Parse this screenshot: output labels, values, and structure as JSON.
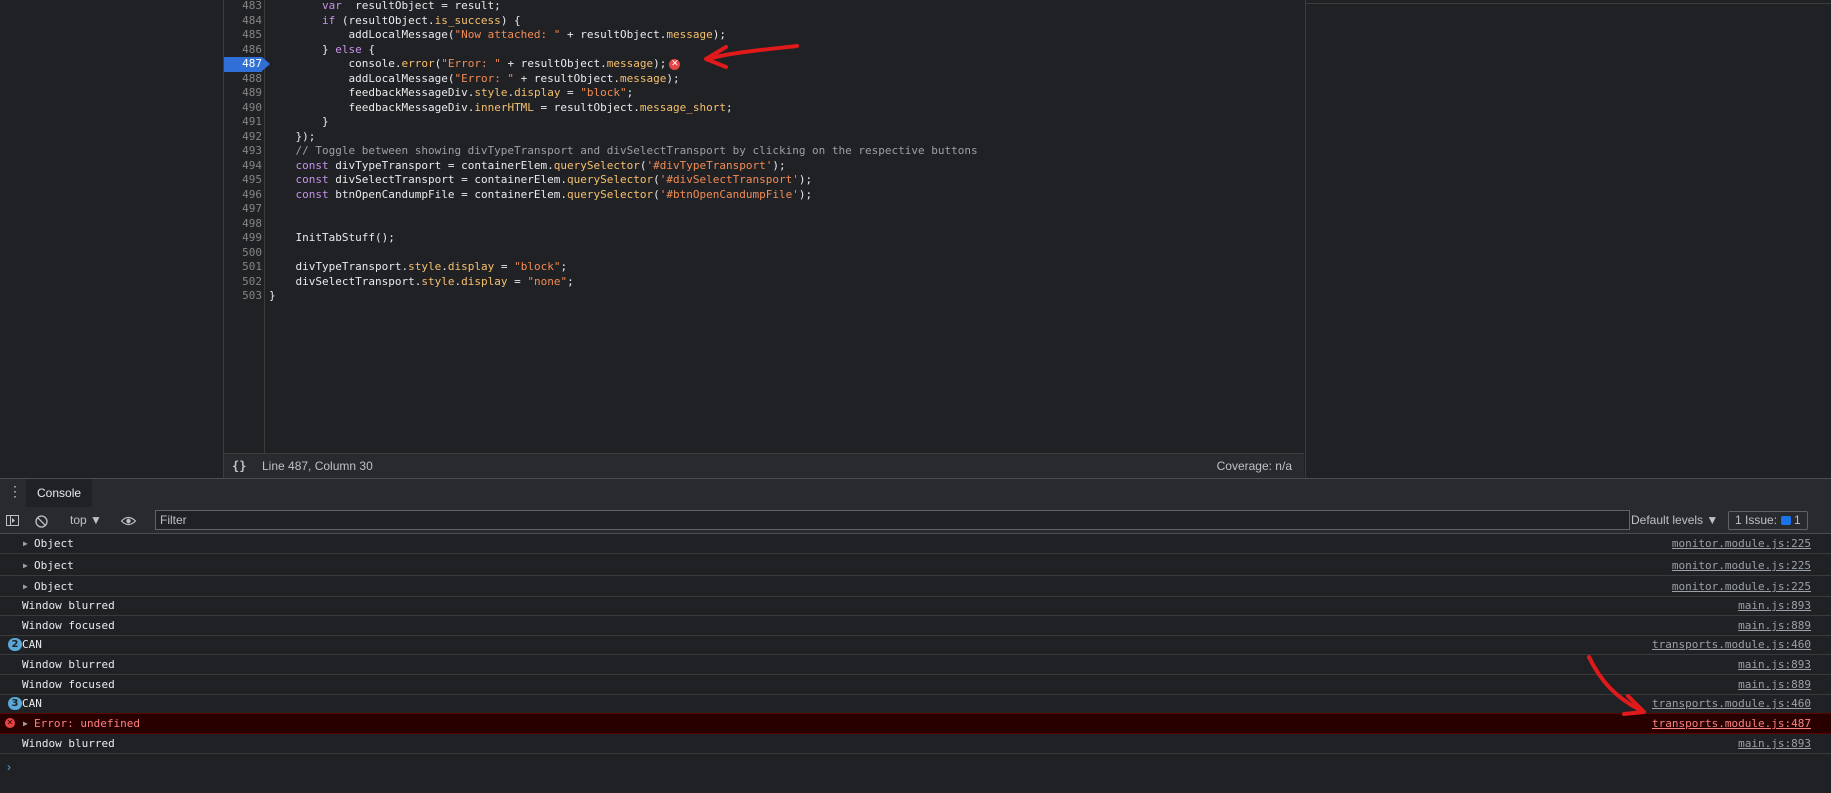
{
  "editor": {
    "lines": [
      {
        "num": "483",
        "indent": "        ",
        "segments": [
          [
            "kw",
            "var"
          ],
          [
            "",
            "  resultObject = result;"
          ]
        ]
      },
      {
        "num": "484",
        "indent": "        ",
        "segments": [
          [
            "kw",
            "if"
          ],
          [
            "",
            " (resultObject."
          ],
          [
            "prop",
            "is_success"
          ],
          [
            "",
            ") {"
          ]
        ]
      },
      {
        "num": "485",
        "indent": "            ",
        "segments": [
          [
            "",
            "addLocalMessage("
          ],
          [
            "str",
            "\"Now attached: \""
          ],
          [
            "",
            ""
          ],
          [
            "",
            " + resultObject."
          ],
          [
            "prop",
            "message"
          ],
          [
            "",
            ");"
          ]
        ]
      },
      {
        "num": "486",
        "indent": "        ",
        "segments": [
          [
            "",
            "} "
          ],
          [
            "kw",
            "else"
          ],
          [
            "",
            " {"
          ]
        ]
      },
      {
        "num": "487",
        "indent": "            ",
        "segments": [
          [
            "",
            "console."
          ],
          [
            "prop",
            "error"
          ],
          [
            "",
            "("
          ],
          [
            "str",
            "\"Error: \""
          ],
          [
            "",
            " + resultObject."
          ],
          [
            "prop",
            "message"
          ],
          [
            "",
            ");"
          ]
        ],
        "active": true,
        "error": true
      },
      {
        "num": "488",
        "indent": "            ",
        "segments": [
          [
            "",
            "addLocalMessage("
          ],
          [
            "str",
            "\"Error: \""
          ],
          [
            "",
            " + resultObject."
          ],
          [
            "prop",
            "message"
          ],
          [
            "",
            ");"
          ]
        ]
      },
      {
        "num": "489",
        "indent": "            ",
        "segments": [
          [
            "",
            "feedbackMessageDiv."
          ],
          [
            "prop",
            "style"
          ],
          [
            "",
            "."
          ],
          [
            "prop",
            "display"
          ],
          [
            "",
            " = "
          ],
          [
            "str",
            "\"block\""
          ],
          [
            "",
            ";"
          ]
        ]
      },
      {
        "num": "490",
        "indent": "            ",
        "segments": [
          [
            "",
            "feedbackMessageDiv."
          ],
          [
            "prop",
            "innerHTML"
          ],
          [
            "",
            " = resultObject."
          ],
          [
            "prop",
            "message_short"
          ],
          [
            "",
            ";"
          ]
        ]
      },
      {
        "num": "491",
        "indent": "        ",
        "segments": [
          [
            "",
            "}"
          ]
        ]
      },
      {
        "num": "492",
        "indent": "    ",
        "segments": [
          [
            "",
            "});"
          ]
        ]
      },
      {
        "num": "493",
        "indent": "    ",
        "segments": [
          [
            "cmt",
            "// Toggle between showing divTypeTransport and divSelectTransport by clicking on the respective buttons"
          ]
        ]
      },
      {
        "num": "494",
        "indent": "    ",
        "segments": [
          [
            "kw",
            "const"
          ],
          [
            "",
            " divTypeTransport = containerElem."
          ],
          [
            "prop",
            "querySelector"
          ],
          [
            "",
            "("
          ],
          [
            "str",
            "'#divTypeTransport'"
          ],
          [
            "",
            ");"
          ]
        ]
      },
      {
        "num": "495",
        "indent": "    ",
        "segments": [
          [
            "kw",
            "const"
          ],
          [
            "",
            " divSelectTransport = containerElem."
          ],
          [
            "prop",
            "querySelector"
          ],
          [
            "",
            "("
          ],
          [
            "str",
            "'#divSelectTransport'"
          ],
          [
            "",
            ");"
          ]
        ]
      },
      {
        "num": "496",
        "indent": "    ",
        "segments": [
          [
            "kw",
            "const"
          ],
          [
            "",
            " btnOpenCandumpFile = containerElem."
          ],
          [
            "prop",
            "querySelector"
          ],
          [
            "",
            "("
          ],
          [
            "str",
            "'#btnOpenCandumpFile'"
          ],
          [
            "",
            ");"
          ]
        ]
      },
      {
        "num": "497",
        "indent": "",
        "segments": []
      },
      {
        "num": "498",
        "indent": "",
        "segments": []
      },
      {
        "num": "499",
        "indent": "    ",
        "segments": [
          [
            "",
            "InitTabStuff();"
          ]
        ]
      },
      {
        "num": "500",
        "indent": "",
        "segments": []
      },
      {
        "num": "501",
        "indent": "    ",
        "segments": [
          [
            "",
            "divTypeTransport."
          ],
          [
            "prop",
            "style"
          ],
          [
            "",
            "."
          ],
          [
            "prop",
            "display"
          ],
          [
            "",
            " = "
          ],
          [
            "str",
            "\"block\""
          ],
          [
            "",
            ";"
          ]
        ]
      },
      {
        "num": "502",
        "indent": "    ",
        "segments": [
          [
            "",
            "divSelectTransport."
          ],
          [
            "prop",
            "style"
          ],
          [
            "",
            "."
          ],
          [
            "prop",
            "display"
          ],
          [
            "",
            " = "
          ],
          [
            "str",
            "\"none\""
          ],
          [
            "",
            ";"
          ]
        ]
      },
      {
        "num": "503",
        "indent": "",
        "segments": [
          [
            "",
            "}"
          ]
        ]
      }
    ]
  },
  "statusbar": {
    "pretty_print": "{}",
    "cursor": "Line 487, Column 30",
    "coverage": "Coverage: n/a"
  },
  "drawer": {
    "menu_icon": "⋮",
    "console_tab": "Console"
  },
  "toolbar": {
    "context": "top ▼",
    "filter_placeholder": "Filter",
    "levels": "Default levels ▼",
    "issues": "1 Issue:",
    "issues_count": "1"
  },
  "console": {
    "rows": [
      {
        "type": "object",
        "msg": "Object",
        "src": "monitor.module.js:225"
      },
      {
        "type": "object",
        "msg": "Object",
        "src": "monitor.module.js:225"
      },
      {
        "type": "object",
        "msg": "Object",
        "src": "monitor.module.js:225"
      },
      {
        "type": "log",
        "msg": "Window blurred",
        "src": "main.js:893"
      },
      {
        "type": "log",
        "msg": "Window focused",
        "src": "main.js:889"
      },
      {
        "type": "repeat",
        "count": "2",
        "msg": "CAN",
        "src": "transports.module.js:460"
      },
      {
        "type": "log",
        "msg": "Window blurred",
        "src": "main.js:893"
      },
      {
        "type": "log",
        "msg": "Window focused",
        "src": "main.js:889"
      },
      {
        "type": "repeat",
        "count": "3",
        "msg": "CAN",
        "src": "transports.module.js:460"
      },
      {
        "type": "error",
        "msg": "Error: undefined",
        "src": "transports.module.js:487"
      },
      {
        "type": "log",
        "msg": "Window blurred",
        "src": "main.js:893"
      }
    ],
    "prompt": "›"
  },
  "colors": {
    "annotation_arrow": "#e0191b",
    "error_background": "#290000",
    "active_line": "#2f6fd6"
  }
}
